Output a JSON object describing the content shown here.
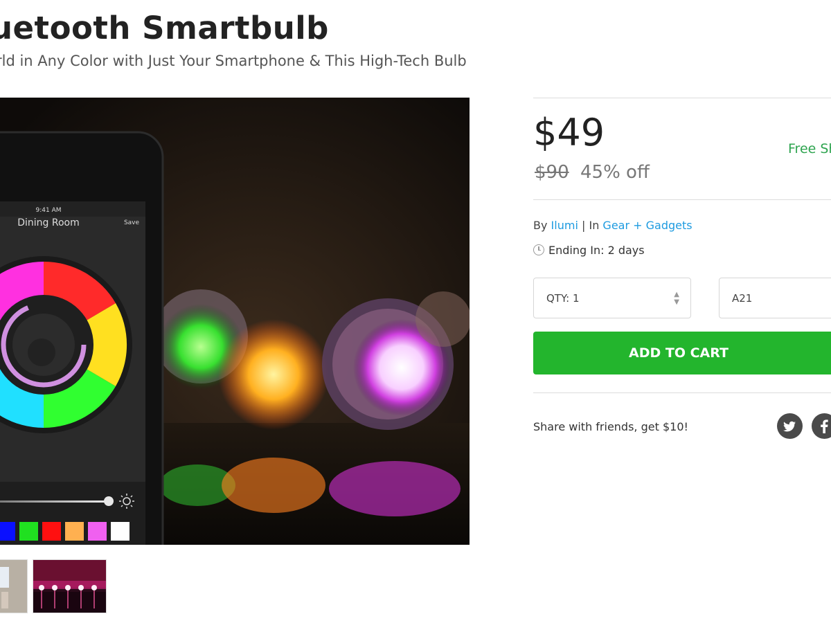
{
  "product": {
    "title": "uetooth Smartbulb",
    "subtitle": "rld in Any Color with Just Your Smartphone & This High-Tech Bulb"
  },
  "phone_app": {
    "time": "9:41 AM",
    "room": "Dining Room",
    "save_label": "Save",
    "swatches": [
      "#0a10ff",
      "#20e020",
      "#ff1010",
      "#ffb050",
      "#f060f0",
      "#ffffff"
    ]
  },
  "pricing": {
    "price": "$49",
    "original_price": "$90",
    "discount": "45% off",
    "shipping": "Free Sh"
  },
  "meta": {
    "by_prefix": "By",
    "brand": "Ilumi",
    "separator": "|",
    "in_prefix": "In",
    "category": "Gear + Gadgets",
    "ending": "Ending In: 2 days"
  },
  "options": {
    "qty_label": "QTY: 1",
    "variant": "A21"
  },
  "actions": {
    "add_to_cart": "ADD TO CART",
    "share_text": "Share with friends, get $10!"
  },
  "colors": {
    "accent_green": "#23b52d",
    "link_blue": "#1e9be0",
    "shipping_green": "#2ea44f"
  },
  "icons": [
    "clock-icon",
    "twitter-icon",
    "facebook-icon",
    "spinner-arrows-icon"
  ]
}
